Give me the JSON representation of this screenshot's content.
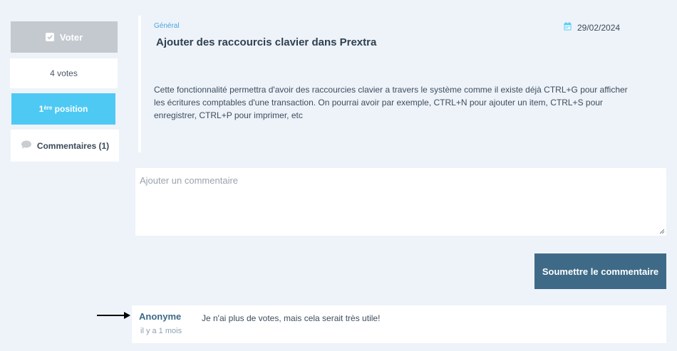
{
  "sidebar": {
    "vote_label": "Voter",
    "votes_label": "4 votes",
    "position_number": "1",
    "position_suffix": "ère",
    "position_label": " position",
    "comments_label": "Commentaires (1)"
  },
  "article": {
    "category": "Général",
    "title": "Ajouter des raccourcis clavier dans Prextra",
    "date": "29/02/2024",
    "description": "Cette fonctionnalité permettra d'avoir des raccourcies clavier a travers le système comme il existe déjà CTRL+G pour afficher les écritures comptables d'une transaction. On pourrai avoir par exemple, CTRL+N pour ajouter un item, CTRL+S pour enregistrer, CTRL+P pour imprimer, etc"
  },
  "comment_form": {
    "placeholder": "Ajouter un commentaire",
    "value": "",
    "submit_label": "Soumettre le commentaire"
  },
  "comments": [
    {
      "author": "Anonyme",
      "time": "il y a 1 mois",
      "text": "Je n'ai plus de votes, mais cela serait très utile!"
    }
  ],
  "colors": {
    "background": "#eef3fa",
    "vote_button": "#c4c9cf",
    "position_badge": "#4ec9f4",
    "submit_button": "#3e6a87",
    "category_text": "#4fa3d9",
    "calendar_icon": "#4ec9f4"
  },
  "icons": {
    "vote": "checkbox-checked-icon",
    "comments": "speech-bubble-icon",
    "date": "calendar-icon",
    "pointer": "arrow-right-icon"
  }
}
